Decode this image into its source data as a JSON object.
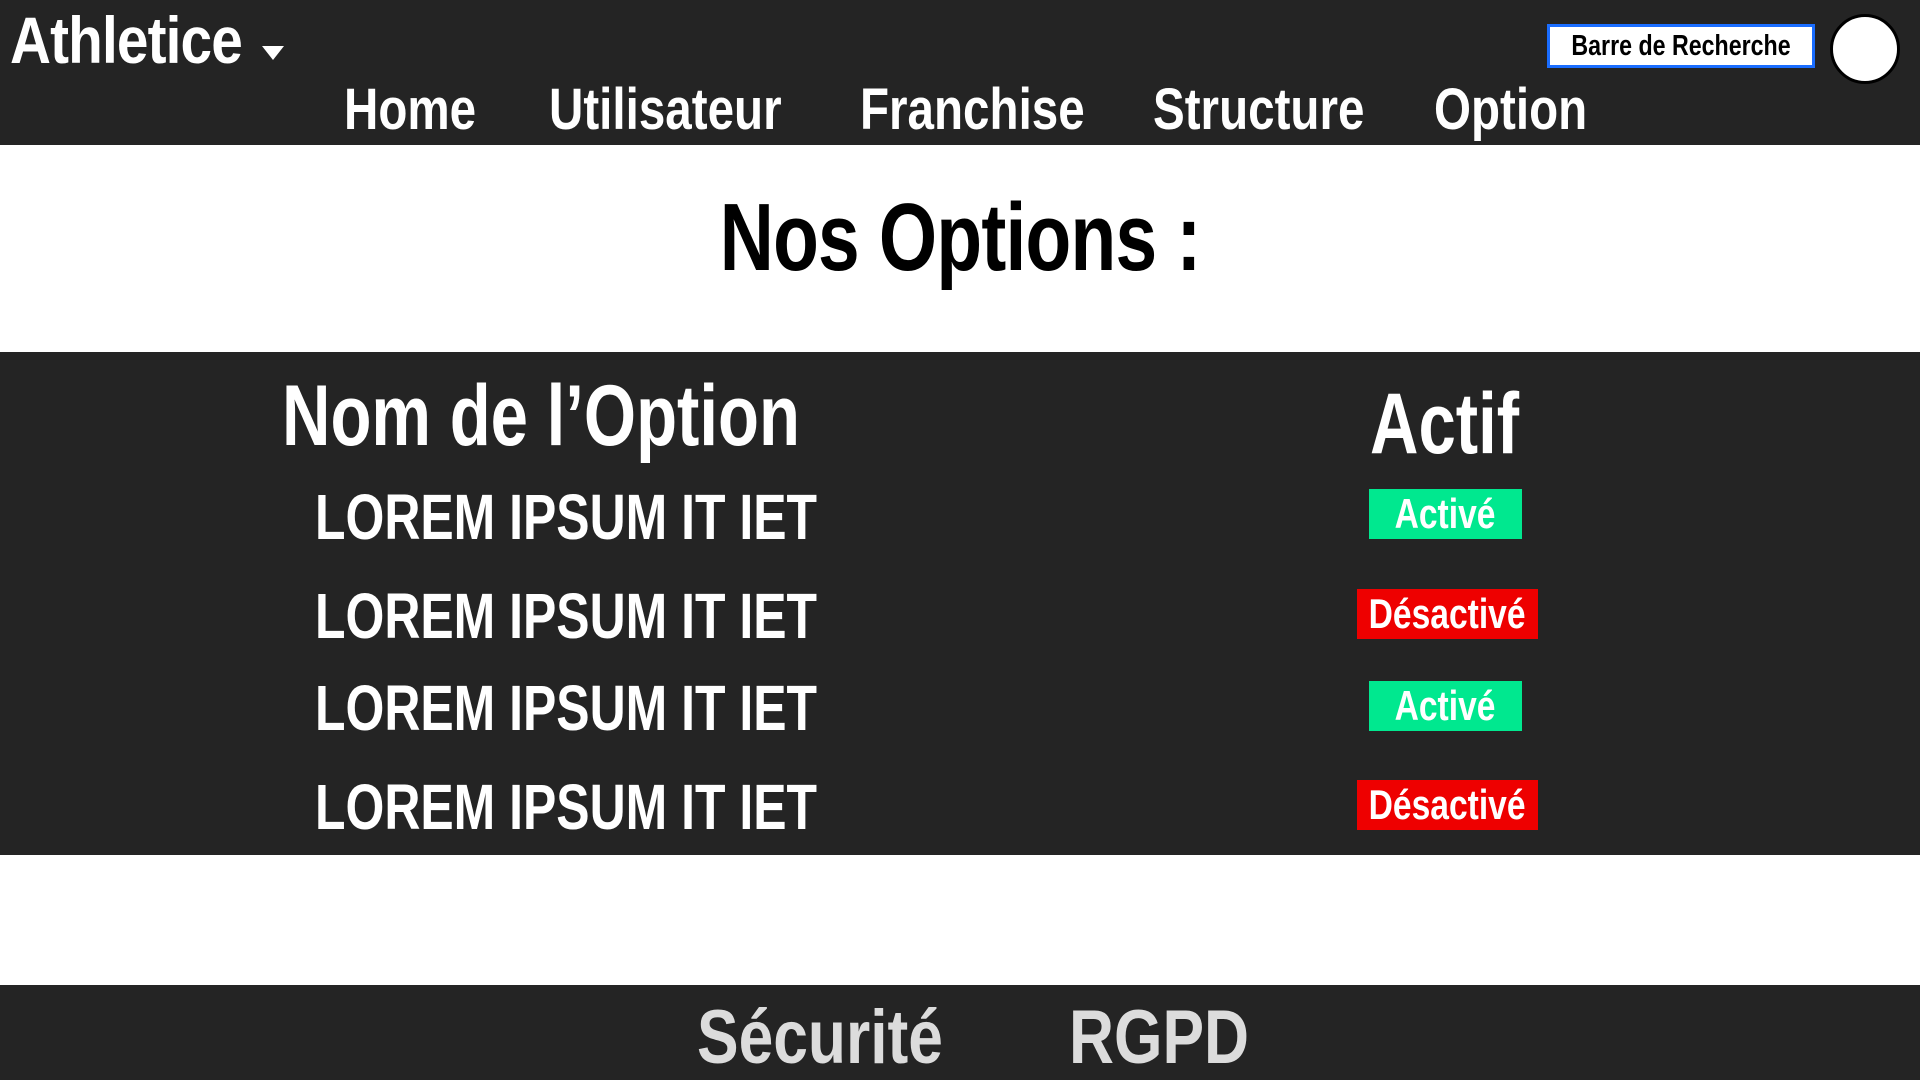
{
  "header": {
    "brand": "Athletice",
    "nav": [
      "Home",
      "Utilisateur",
      "Franchise",
      "Structure",
      "Option"
    ],
    "search_label": "Barre de Recherche"
  },
  "main": {
    "title": "Nos Options :"
  },
  "table": {
    "columns": [
      "Nom de l’Option",
      "Actif"
    ],
    "rows": [
      {
        "name": "LOREM IPSUM IT IET",
        "status": "Activé",
        "active": true
      },
      {
        "name": "LOREM IPSUM IT IET",
        "status": "Désactivé",
        "active": false
      },
      {
        "name": "LOREM IPSUM IT IET",
        "status": "Activé",
        "active": true
      },
      {
        "name": "LOREM IPSUM IT IET",
        "status": "Désactivé",
        "active": false
      }
    ]
  },
  "footer": {
    "links": [
      "Sécurité",
      "RGPD"
    ]
  },
  "colors": {
    "bar_background": "#242424",
    "active_badge": "#00e88f",
    "inactive_badge": "#ee0000",
    "search_border": "#1a6dff"
  }
}
